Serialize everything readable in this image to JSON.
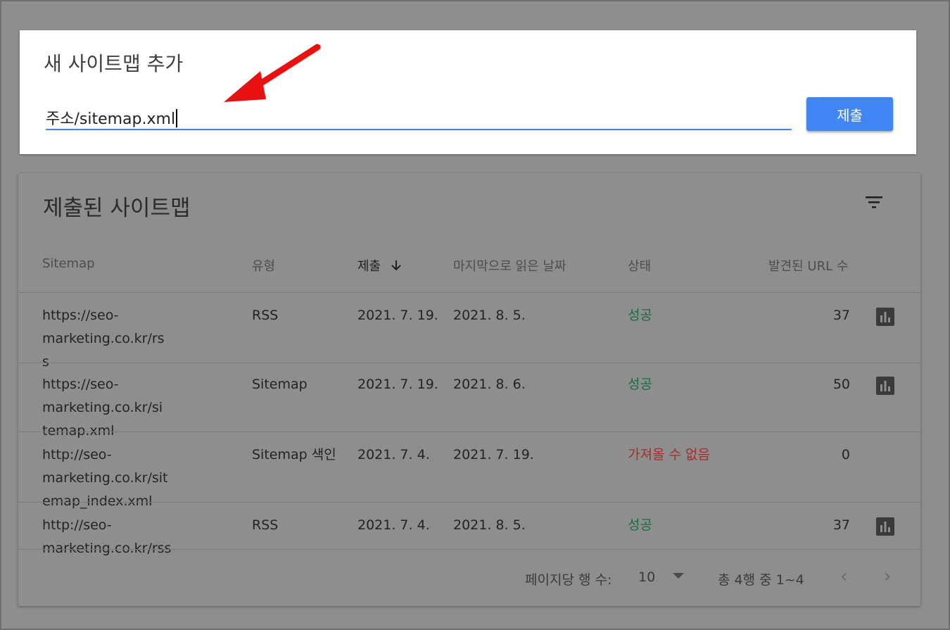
{
  "add_sitemap": {
    "title": "새 사이트맵 추가",
    "input_value": "주소/sitemap.xml",
    "submit_label": "제출"
  },
  "submitted": {
    "title": "제출된 사이트맵",
    "columns": {
      "sitemap": "Sitemap",
      "type": "유형",
      "submitted": "제출",
      "last_read": "마지막으로 읽은 날짜",
      "status": "상태",
      "urls": "발견된 URL 수"
    },
    "rows": [
      {
        "sitemap_l1": "https://seo-marketing.co.kr/rs",
        "sitemap_l2": "s",
        "type": "RSS",
        "submitted": "2021. 7. 19.",
        "last_read": "2021. 8. 5.",
        "status": "성공",
        "urls": "37"
      },
      {
        "sitemap_l1": "https://seo-marketing.co.kr/si",
        "sitemap_l2": "temap.xml",
        "type": "Sitemap",
        "submitted": "2021. 7. 19.",
        "last_read": "2021. 8. 6.",
        "status": "성공",
        "urls": "50"
      },
      {
        "sitemap_l1": "http://seo-marketing.co.kr/sit",
        "sitemap_l2": "emap_index.xml",
        "type": "Sitemap 색인",
        "submitted": "2021. 7. 4.",
        "last_read": "2021. 7. 19.",
        "status": "가져올 수 없음",
        "urls": "0"
      },
      {
        "sitemap_l1": "http://seo-marketing.co.kr/rss",
        "sitemap_l2": "",
        "type": "RSS",
        "submitted": "2021. 7. 4.",
        "last_read": "2021. 8. 5.",
        "status": "성공",
        "urls": "37"
      }
    ],
    "footer": {
      "rows_per_page_label": "페이지당 행 수:",
      "rows_per_page_value": "10",
      "range": "총 4행 중 1~4",
      "prev": "‹",
      "next": "›"
    }
  },
  "colors": {
    "accent": "#4285f4",
    "success": "#1a6b3f",
    "error": "#a82d2d",
    "arrow": "#e81010"
  },
  "icons": [
    "filter-icon",
    "sort-down-arrow-icon",
    "bar-chart-icon",
    "dropdown-caret-icon",
    "chevron-left-icon",
    "chevron-right-icon"
  ]
}
